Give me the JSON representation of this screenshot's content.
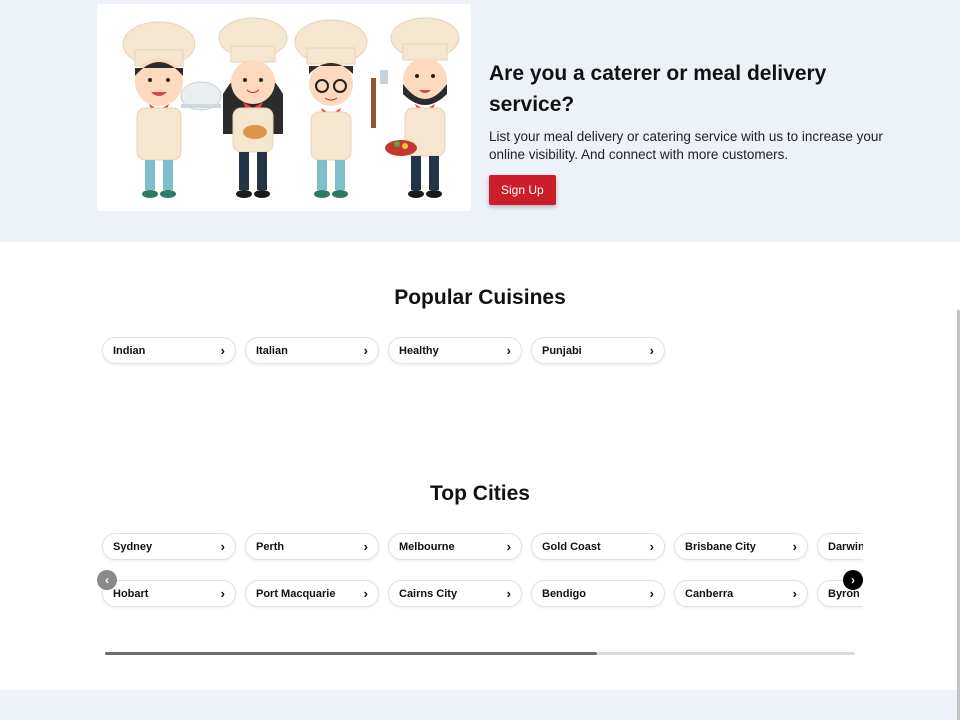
{
  "hero": {
    "title": "Are you a caterer or meal delivery service?",
    "description": "List your meal delivery or catering service with us to increase your online visibility. And connect with more customers.",
    "signup_label": "Sign Up",
    "accent": "#cc1e2a",
    "background": "#edf1f8"
  },
  "cuisines": {
    "title": "Popular Cuisines",
    "items": [
      "Indian",
      "Italian",
      "Healthy",
      "Punjabi"
    ]
  },
  "cities": {
    "title": "Top Cities",
    "row1": [
      "Sydney",
      "Perth",
      "Melbourne",
      "Gold Coast",
      "Brisbane City",
      "Darwin"
    ],
    "row2": [
      "Hobart",
      "Port Macquarie",
      "Cairns City",
      "Bendigo",
      "Canberra",
      "Byron Bay"
    ],
    "prev_icon": "chevron-left-icon",
    "next_icon": "chevron-right-icon"
  },
  "carousel_progress": 0.656
}
